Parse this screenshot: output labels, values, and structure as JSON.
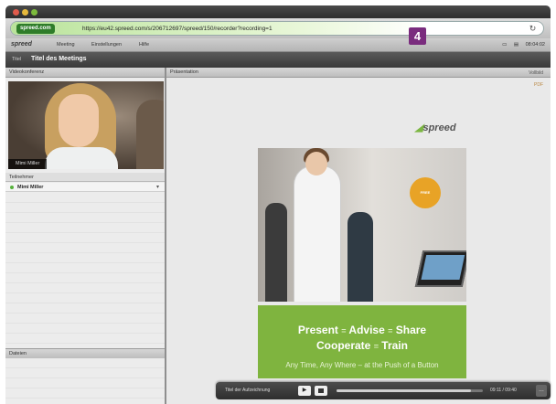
{
  "window": {
    "address_badge": "spreed.com",
    "url": "https://eu42.spreed.com/s/206712697/spreed/150/recorder?recording=1",
    "step_number": "4"
  },
  "menubar": {
    "logo": "spreed",
    "items": [
      "Meeting",
      "Einstellungen",
      "Hilfe"
    ],
    "clock": "08:04:02"
  },
  "titlebar": {
    "label": "Titel",
    "meeting_title": "Titel des Meetings"
  },
  "left": {
    "video_header": "Videokonferenz",
    "video_name": "Mimi Miller",
    "participants_header": "Teilnehmer",
    "participants": [
      {
        "name": "Mimi Miller",
        "status_color": "#56b13c"
      }
    ],
    "files_header": "Dateien"
  },
  "right": {
    "header": "Präsentation",
    "tool1": "Vollbild",
    "tool2": "PDF",
    "brand": "spreed",
    "slide": {
      "badge": "FREE",
      "tagline1": [
        "Present",
        "Advise",
        "Share"
      ],
      "tagline2": [
        "Cooperate",
        "Train"
      ],
      "separator": "=",
      "tagline3": "Any Time, Any Where – at the Push of a Button"
    }
  },
  "player": {
    "label": "Titel der Aufzeichnung",
    "play_icon": "play-icon",
    "time": "09:11 / 09:40",
    "progress": 0.92,
    "more": "…"
  },
  "colors": {
    "accent_green": "#7fb43f",
    "step_badge": "#7a2c7e"
  }
}
